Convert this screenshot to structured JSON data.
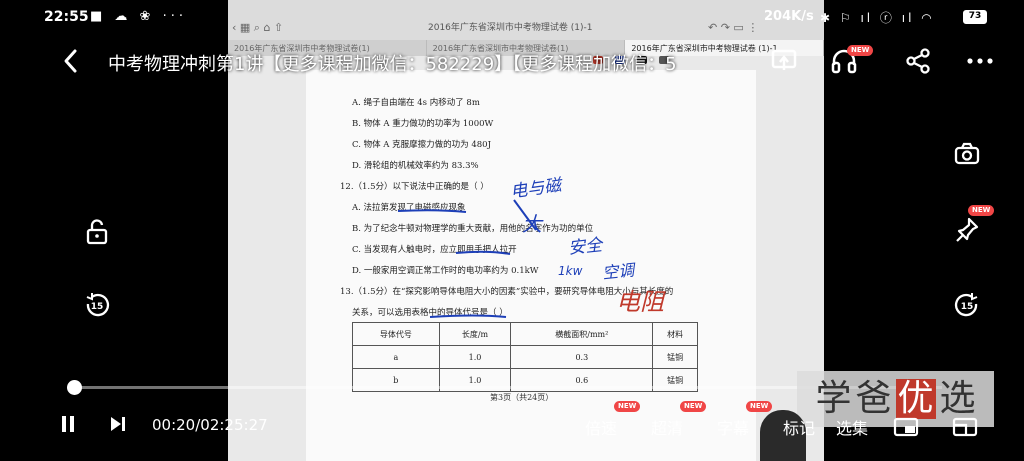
{
  "status_bar": {
    "time": "22:55",
    "left_icons": "■ ☁ ❀ ···",
    "net_speed": "204K/s",
    "right_icons": "✱ ⚐ ıl ⓡ ıl ◠",
    "battery": "73"
  },
  "video": {
    "title": "中考物理冲刺第1讲【更多课程加微信：582229】【更多课程加微信：5",
    "elapsed": "00:20",
    "duration": "02:25:27",
    "time_display": "00:20/02:25:27",
    "progress": 0.0023
  },
  "badges": {
    "new": "NEW"
  },
  "controls": {
    "speed": "倍速",
    "quality": "超清",
    "subtitles": "字幕",
    "bookmark": "标记",
    "episodes": "选集"
  },
  "watermark": {
    "c1": "学",
    "c2": "爸",
    "c3": "优",
    "c4": "选"
  },
  "tablet": {
    "tab_title": "2016年广东省深圳市中考物理试卷 (1)-1",
    "tabs": [
      "2016年广东省深圳市中考物理试卷(1)",
      "2016年广东省深圳市中考物理试卷(1)",
      "2016年广东省深圳市中考物理试卷 (1)-1"
    ],
    "lines": [
      "A. 绳子自由端在 4s 内移动了 8m",
      "B. 物体 A 重力做功的功率为 1000W",
      "C. 物体 A 克服摩擦力做的功为 480J",
      "D. 滑轮组的机械效率约为 83.3%",
      "12.（1.5分）以下说法中正确的是（     ）",
      "A. 法拉第发现了电磁感应现象",
      "B. 为了纪念牛顿对物理学的重大贡献，用他的名字作为功的单位",
      "C. 当发现有人触电时，应立即用手把人拉开",
      "D. 一般家用空调正常工作时的电功率约为 0.1kW",
      "13.（1.5分）在“探究影响导体电阻大小的因素”实验中，要研究导体电阻大小与其长度的",
      "关系，可以选用表格中的导体代号是（     ）"
    ],
    "table_headers": [
      "导体代号",
      "长度/m",
      "横截面积/mm²",
      "材料"
    ],
    "table_rows": [
      [
        "a",
        "1.0",
        "0.3",
        "锰铜"
      ],
      [
        "b",
        "1.0",
        "0.6",
        "锰铜"
      ]
    ],
    "page_footer": "第3页（共24页）",
    "ink": {
      "note1": "电与磁",
      "note2": "大",
      "note3": "安全",
      "note4": "1kw",
      "note5": "空调",
      "note6": "电阻"
    }
  },
  "colors": {
    "ink_blue": "#1d3fb8",
    "ink_red": "#c0392b",
    "badge_red": "#f04646"
  }
}
